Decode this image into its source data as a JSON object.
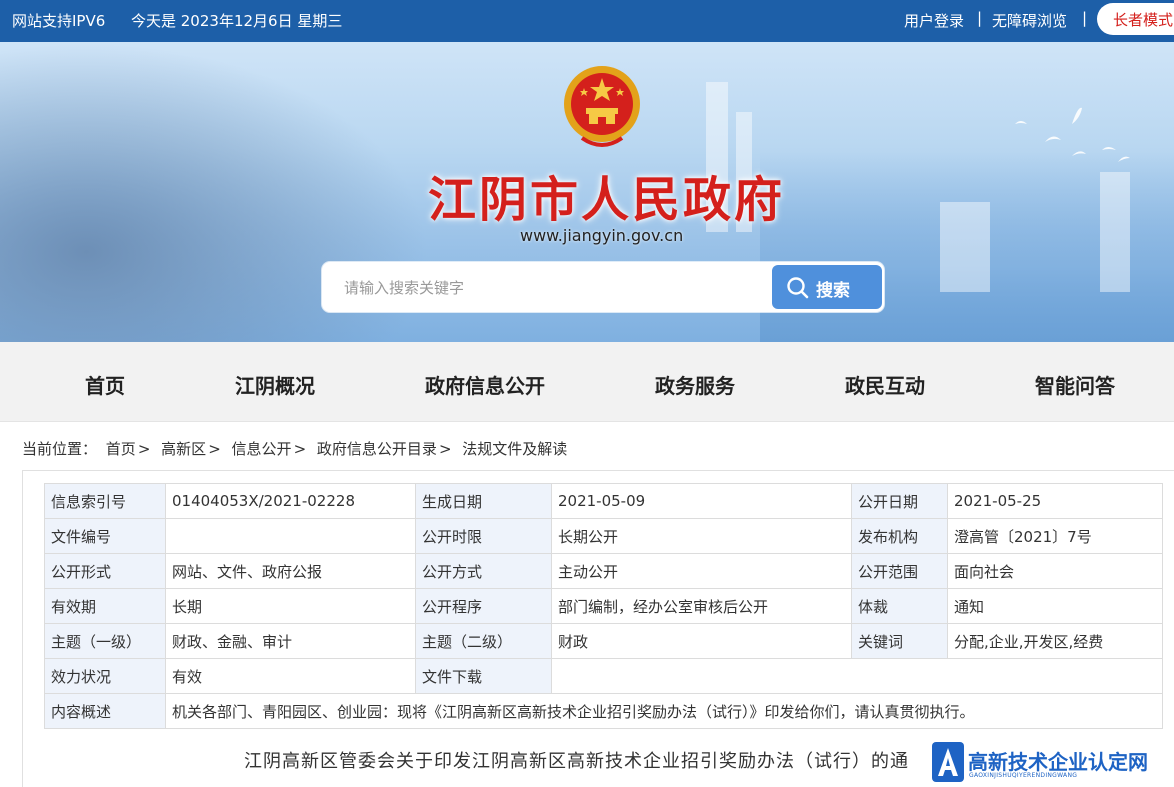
{
  "topbar": {
    "ipv6": "网站支持IPV6",
    "date": "今天是 2023年12月6日 星期三",
    "login": "用户登录",
    "separator": "|",
    "barrier_free": "无障碍浏览",
    "elder_mode": "长者模式"
  },
  "header": {
    "site_title": "江阴市人民政府",
    "site_url": "www.jiangyin.gov.cn",
    "search_placeholder": "请输入搜索关键字",
    "search_button": "搜索"
  },
  "nav": [
    "首页",
    "江阴概况",
    "政府信息公开",
    "政务服务",
    "政民互动",
    "智能问答"
  ],
  "breadcrumb": {
    "prefix": "当前位置：",
    "items": [
      "首页",
      "高新区",
      "信息公开",
      "政府信息公开目录",
      "法规文件及解读"
    ],
    "separator": ">"
  },
  "meta": {
    "rows": [
      [
        {
          "k": "信息索引号",
          "v": "01404053X/2021-02228"
        },
        {
          "k": "生成日期",
          "v": "2021-05-09"
        },
        {
          "k": "公开日期",
          "v": "2021-05-25"
        }
      ],
      [
        {
          "k": "文件编号",
          "v": ""
        },
        {
          "k": "公开时限",
          "v": "长期公开"
        },
        {
          "k": "发布机构",
          "v": "澄高管〔2021〕7号"
        }
      ],
      [
        {
          "k": "公开形式",
          "v": "网站、文件、政府公报"
        },
        {
          "k": "公开方式",
          "v": "主动公开"
        },
        {
          "k": "公开范围",
          "v": "面向社会"
        }
      ],
      [
        {
          "k": "有效期",
          "v": "长期"
        },
        {
          "k": "公开程序",
          "v": "部门编制，经办公室审核后公开"
        },
        {
          "k": "体裁",
          "v": "通知"
        }
      ],
      [
        {
          "k": "主题（一级）",
          "v": "财政、金融、审计"
        },
        {
          "k": "主题（二级）",
          "v": "财政"
        },
        {
          "k": "关键词",
          "v": "分配,企业,开发区,经费"
        }
      ],
      [
        {
          "k": "效力状况",
          "v": "有效"
        },
        {
          "k": "文件下载",
          "v": ""
        }
      ]
    ],
    "summary_label": "内容概述",
    "summary": "机关各部门、青阳园区、创业园：现将《江阴高新区高新技术企业招引奖励办法（试行）》印发给你们，请认真贯彻执行。"
  },
  "document_title": "江阴高新区管委会关于印发江阴高新区高新技术企业招引奖励办法（试行）的通",
  "watermark": {
    "title": "高新技术企业认定网",
    "subtitle": "GAOXINJISHUQIYERENDINGWANG"
  },
  "colors": {
    "topbar": "#1d5fa8",
    "title_red": "#d4201c",
    "search_button": "#4f90dc",
    "nav_bg": "#f2f2f2",
    "table_key_bg": "#eef3fb",
    "watermark_blue": "#1e63c4"
  }
}
